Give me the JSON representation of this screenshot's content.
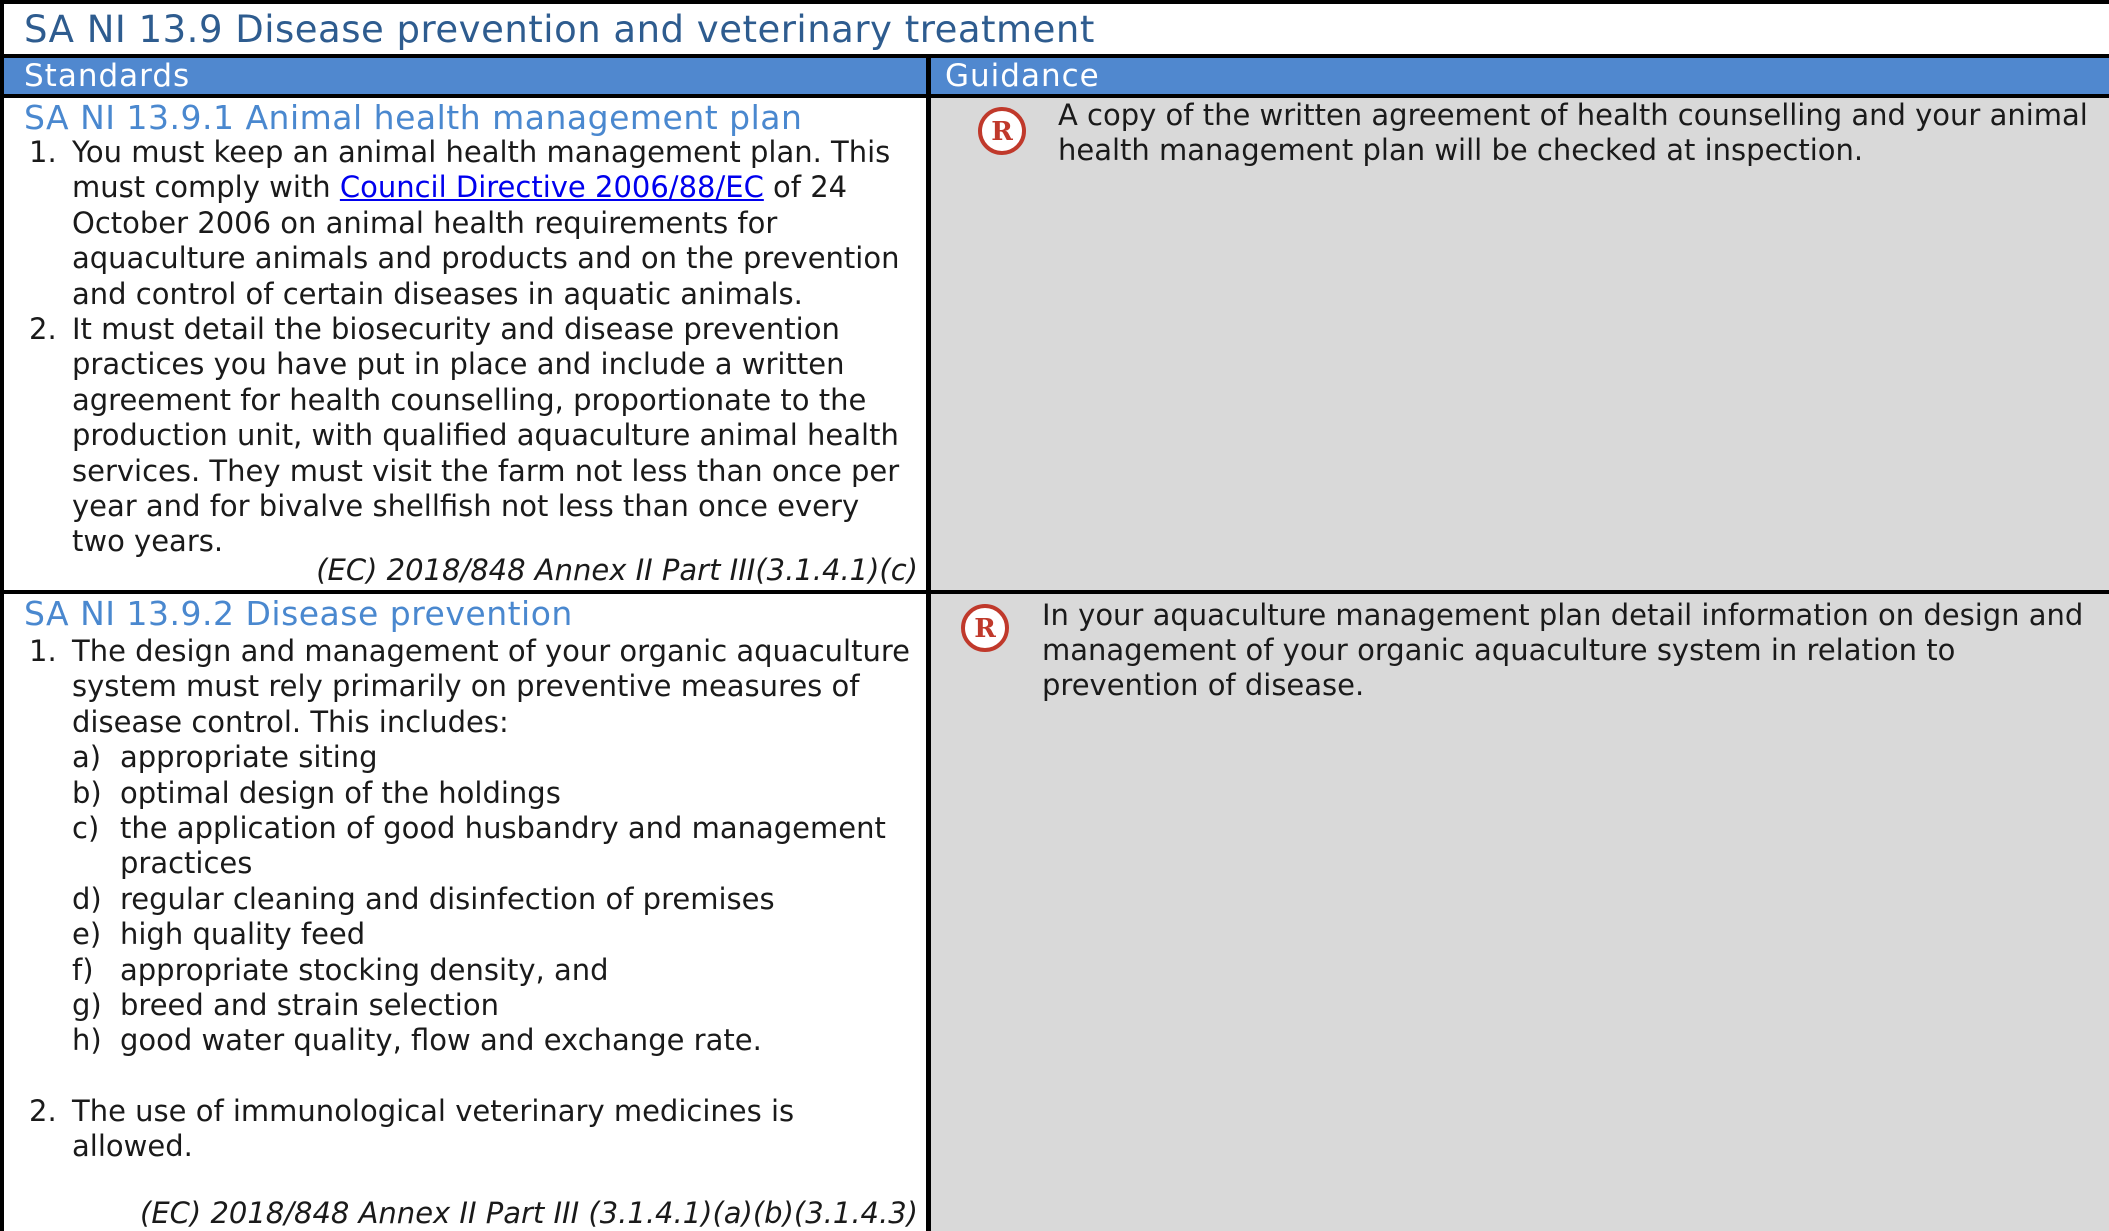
{
  "page": {
    "title": "SA NI 13.9 Disease prevention and veterinary treatment",
    "headers": {
      "standards": "Standards",
      "guidance": "Guidance"
    }
  },
  "sections": [
    {
      "title": "SA NI 13.9.1 Animal health management plan",
      "items": [
        {
          "num": "1.",
          "text_before": "You must keep an animal health management plan. This must comply with ",
          "link": "Council Directive 2006/88/EC",
          "text_after": " of 24 October 2006 on animal health requirements for aquaculture animals and products and on the prevention and control of certain diseases in aquatic animals."
        },
        {
          "num": "2.",
          "text": "It must detail the biosecurity and disease prevention practices you have put in place and include a written agreement for health counselling, proportionate to the production unit, with qualified aquaculture animal health services. They must visit the farm not less than once per year and for bivalve shellfish not less than once every two years."
        }
      ],
      "reference": "(EC) 2018/848 Annex II Part III(3.1.4.1)(c)",
      "guidance_icon": "r-badge-icon",
      "guidance": "A copy of the written agreement of health counselling and your animal health management plan will be checked at inspection."
    },
    {
      "title": "SA NI 13.9.2 Disease prevention",
      "items": [
        {
          "num": "1.",
          "text": "The design and management of your organic aquaculture system must rely primarily on preventive measures of disease control. This includes:",
          "sub": [
            {
              "letter": "a)",
              "text": "appropriate siting"
            },
            {
              "letter": "b)",
              "text": "optimal design of the holdings"
            },
            {
              "letter": "c)",
              "text": "the application of good husbandry and management practices"
            },
            {
              "letter": "d)",
              "text": "regular cleaning and disinfection of premises"
            },
            {
              "letter": "e)",
              "text": "high quality feed"
            },
            {
              "letter": "f)",
              "text": "appropriate stocking density, and"
            },
            {
              "letter": "g)",
              "text": "breed and strain selection"
            },
            {
              "letter": "h)",
              "text": "good water quality, flow and exchange rate."
            }
          ]
        },
        {
          "num": "2.",
          "text": "The use of immunological veterinary medicines is allowed."
        }
      ],
      "reference": "(EC) 2018/848 Annex II Part III (3.1.4.1)(a)(b)(3.1.4.3)",
      "guidance_icon": "r-badge-icon",
      "guidance": "In your aquaculture management plan detail information on design and management of your organic aquaculture system in relation to prevention of disease."
    }
  ],
  "colors": {
    "title_text": "#2e5c8f",
    "header_bg": "#5088cf",
    "section_title": "#4a88cf",
    "guidance_bg": "#d9d9d9",
    "icon_red": "#c0392b",
    "link": "#0000ee"
  }
}
